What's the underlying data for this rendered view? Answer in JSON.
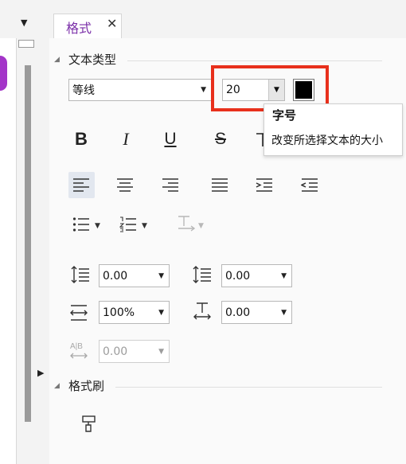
{
  "tab": {
    "label": "格式",
    "close": "✕"
  },
  "sections": {
    "text_type": "文本类型",
    "format_painter": "格式刷"
  },
  "font": {
    "family": "等线",
    "size": "20",
    "color": "#000000"
  },
  "tooltip": {
    "title": "字号",
    "description": "改变所选择文本的大小"
  },
  "format_buttons": {
    "bold": "B",
    "italic": "I",
    "underline": "U",
    "strike": "S"
  },
  "spacing": {
    "line_before": "0.00",
    "line_after": "0.00",
    "line_spacing": "100%",
    "char_spacing": "0.00",
    "disabled_spacing": "0.00"
  },
  "colors": {
    "accent": "#7a2ea8",
    "highlight": "#e8301c",
    "sidebar_tab": "#a335c8"
  }
}
